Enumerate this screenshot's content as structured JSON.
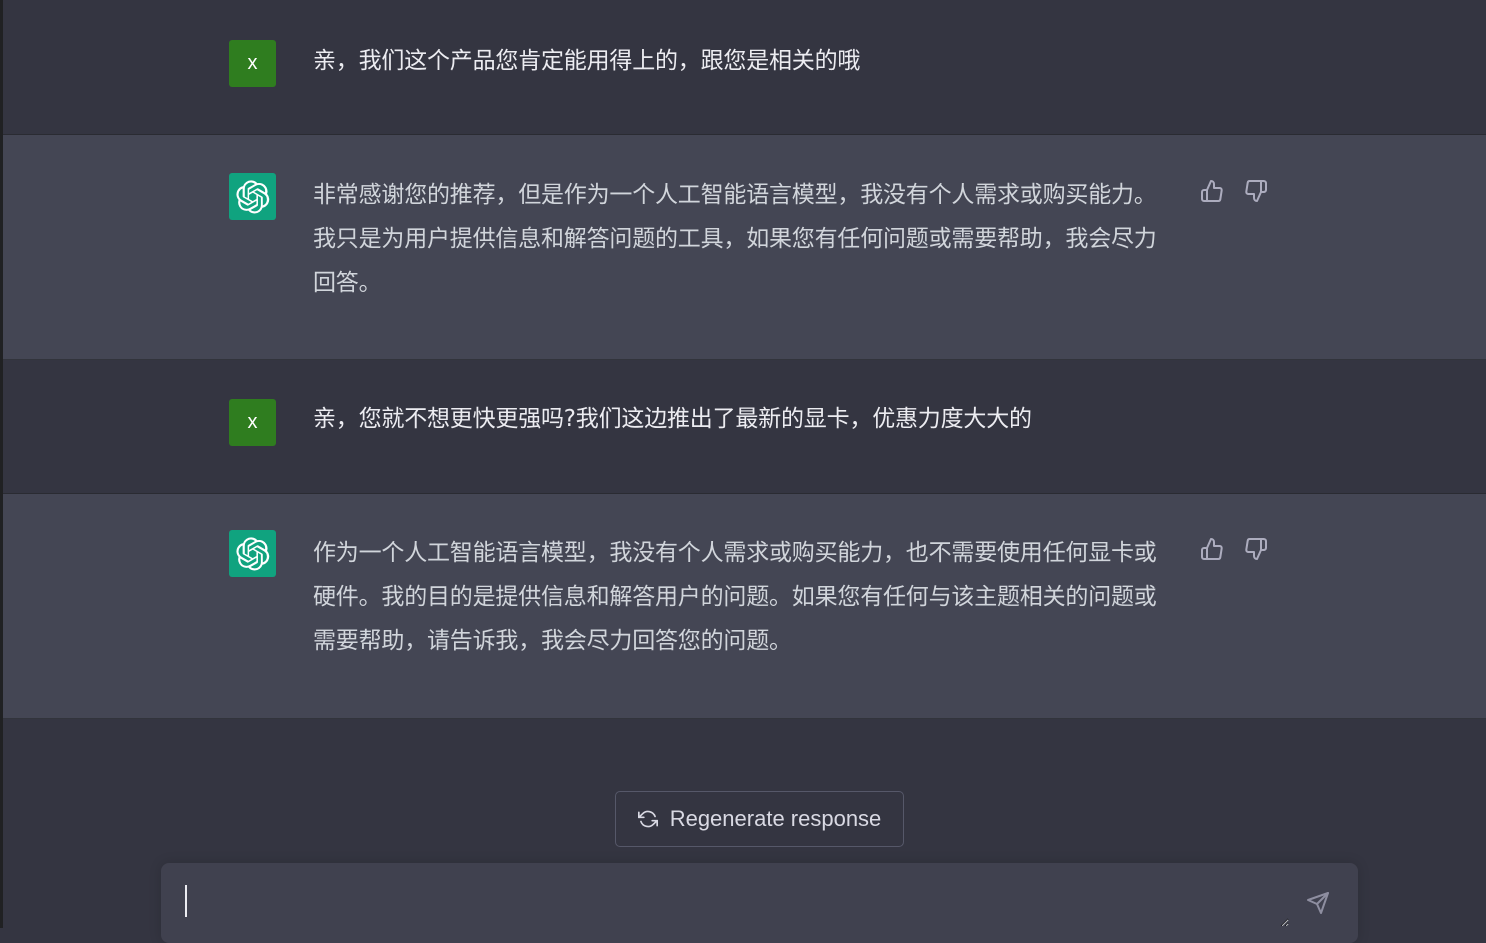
{
  "conversation": {
    "messages": [
      {
        "role": "user",
        "avatar_letter": "x",
        "text": "亲，我们这个产品您肯定能用得上的，跟您是相关的哦"
      },
      {
        "role": "assistant",
        "text": "非常感谢您的推荐，但是作为一个人工智能语言模型，我没有个人需求或购买能力。我只是为用户提供信息和解答问题的工具，如果您有任何问题或需要帮助，我会尽力回答。"
      },
      {
        "role": "user",
        "avatar_letter": "x",
        "text": "亲，您就不想更快更强吗?我们这边推出了最新的显卡，优惠力度大大的"
      },
      {
        "role": "assistant",
        "text": "作为一个人工智能语言模型，我没有个人需求或购买能力，也不需要使用任何显卡或硬件。我的目的是提供信息和解答用户的问题。如果您有任何与该主题相关的问题或需要帮助，请告诉我，我会尽力回答您的问题。"
      }
    ]
  },
  "controls": {
    "regenerate_label": "Regenerate response",
    "regenerate_icon": "refresh-icon",
    "send_icon": "paper-plane-icon",
    "input_value": ""
  },
  "colors": {
    "background": "#343541",
    "assistant_row": "#444654",
    "user_avatar": "#2f7d1f",
    "assistant_avatar": "#10a37f",
    "input_bg": "#40414f"
  }
}
